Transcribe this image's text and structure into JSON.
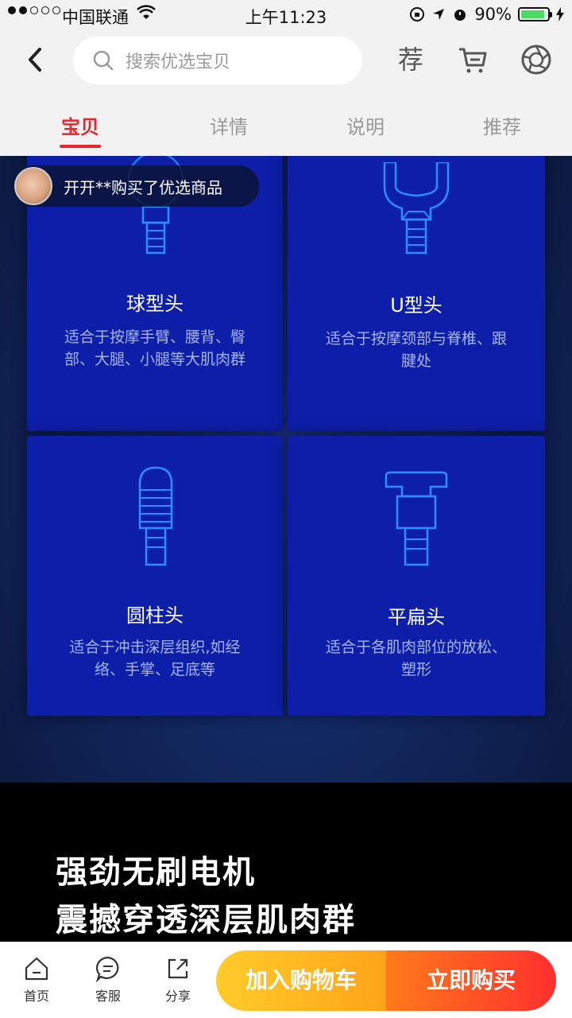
{
  "status_bar": {
    "carrier": "中国联通",
    "time": "上午11:23",
    "battery": "90%",
    "battery_level": 0.9
  },
  "header": {
    "search_placeholder": "搜索优选宝贝",
    "recommend_icon_text": "荐"
  },
  "tabs": [
    {
      "label": "宝贝",
      "active": true
    },
    {
      "label": "详情",
      "active": false
    },
    {
      "label": "说明",
      "active": false
    },
    {
      "label": "推荐",
      "active": false
    }
  ],
  "toast": {
    "message": "开开**购买了优选商品"
  },
  "heads": [
    {
      "title": "球型头",
      "desc": "适合于按摩手臂、腰背、臀部、大腿、小腿等大肌肉群"
    },
    {
      "title": "U型头",
      "desc": "适合于按摩颈部与脊椎、跟腱处"
    },
    {
      "title": "圆柱头",
      "desc": "适合于冲击深层组织,如经络、手掌、足底等"
    },
    {
      "title": "平扁头",
      "desc": "适合于各肌肉部位的放松、塑形"
    }
  ],
  "promo": {
    "line1": "强劲无刷电机",
    "line2": "震撼穿透深层肌肉群"
  },
  "bottom_bar": {
    "home": "首页",
    "service": "客服",
    "share": "分享",
    "add_to_cart": "加入购物车",
    "buy_now": "立即购买"
  },
  "colors": {
    "accent": "#e8262d",
    "card": "#0d1fa8",
    "cart_button": "#ffb21f",
    "buy_button": "#ff4a25"
  }
}
